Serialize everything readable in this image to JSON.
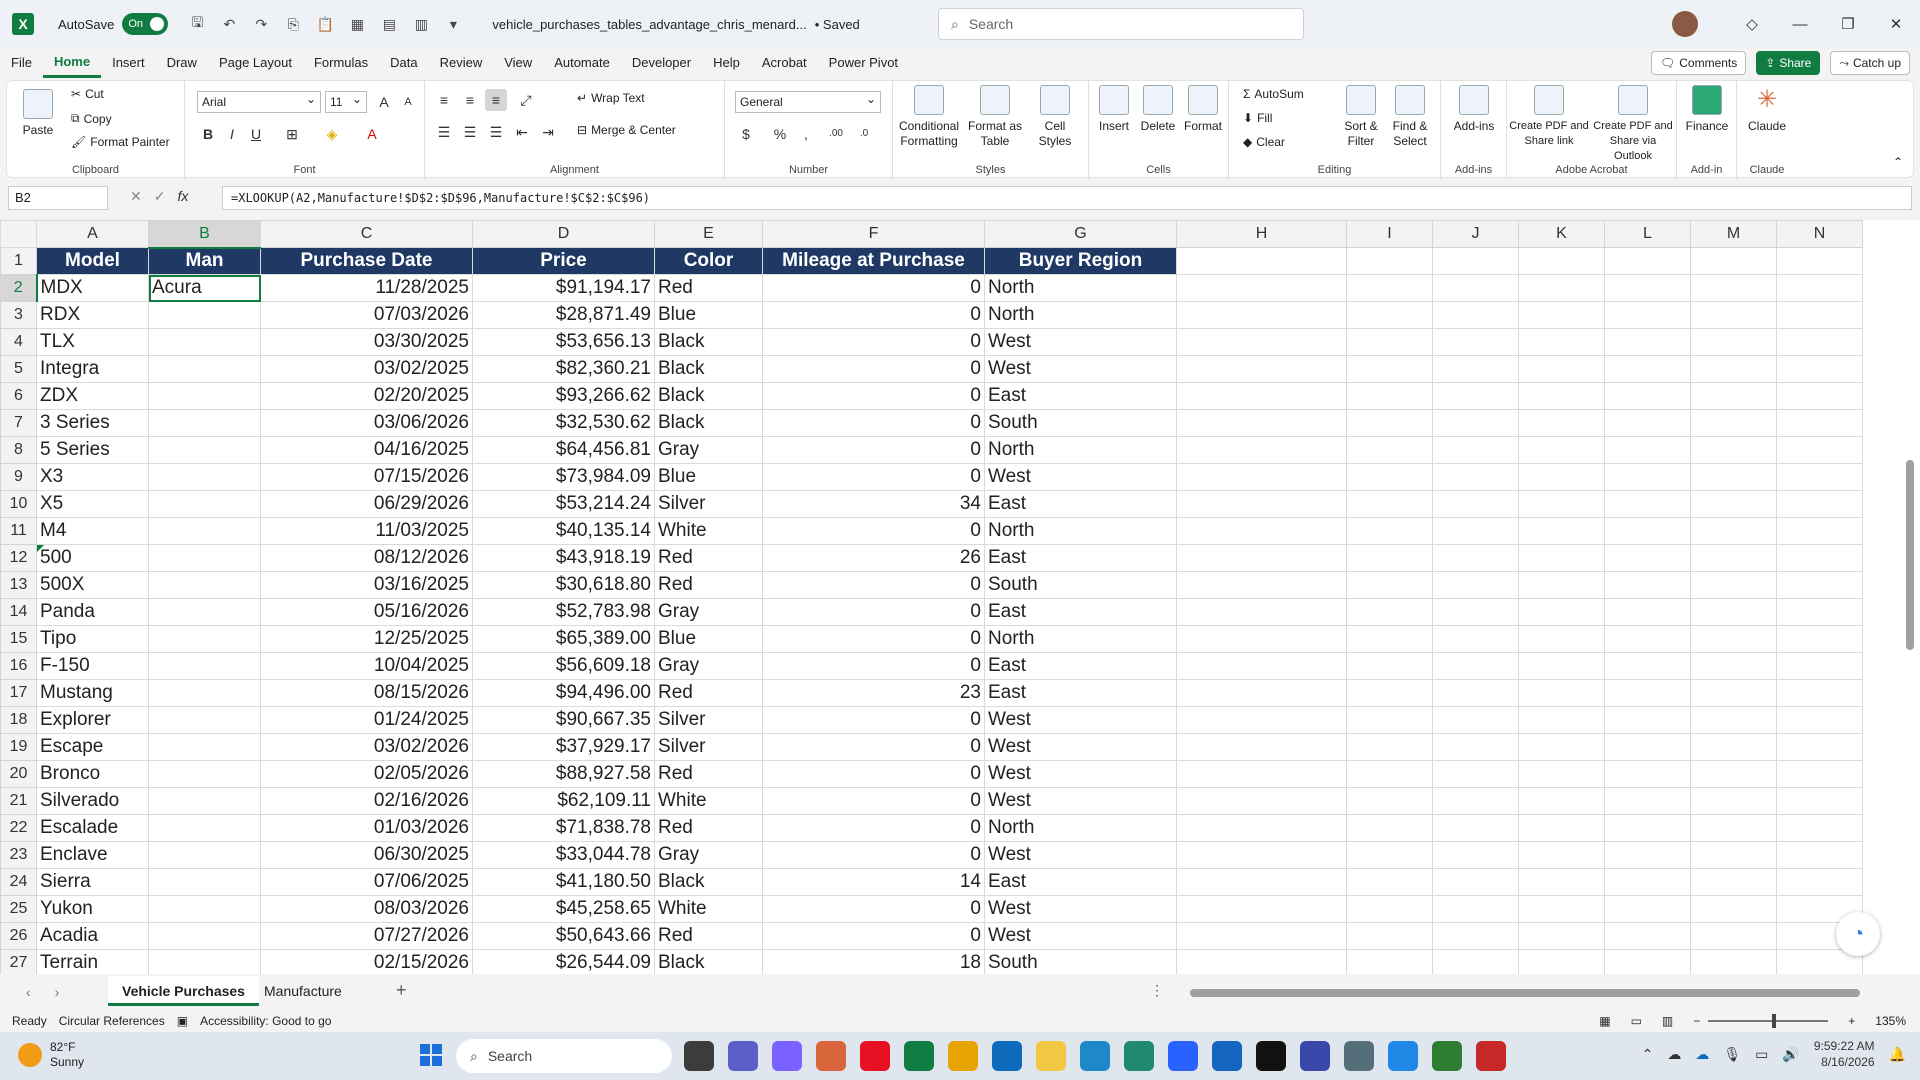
{
  "titlebar": {
    "autosave_label": "AutoSave",
    "autosave_state": "On",
    "filename": "vehicle_purchases_tables_advantage_chris_menard...",
    "saved_status": "• Saved",
    "search_placeholder": "Search"
  },
  "menu": {
    "tabs": [
      "File",
      "Home",
      "Insert",
      "Draw",
      "Page Layout",
      "Formulas",
      "Data",
      "Review",
      "View",
      "Automate",
      "Developer",
      "Help",
      "Acrobat",
      "Power Pivot"
    ],
    "comments": "Comments",
    "share": "Share",
    "catchup": "Catch up"
  },
  "ribbon": {
    "clipboard": {
      "paste": "Paste",
      "cut": "Cut",
      "copy": "Copy",
      "format_painter": "Format Painter",
      "label": "Clipboard"
    },
    "font": {
      "name": "Arial",
      "size": "11",
      "label": "Font"
    },
    "alignment": {
      "wrap": "Wrap Text",
      "merge": "Merge & Center",
      "label": "Alignment"
    },
    "number": {
      "format": "General",
      "label": "Number"
    },
    "styles": {
      "conditional": "Conditional Formatting",
      "format_table": "Format as Table",
      "cell_styles": "Cell Styles",
      "label": "Styles"
    },
    "cells": {
      "insert": "Insert",
      "delete": "Delete",
      "format": "Format",
      "label": "Cells"
    },
    "editing": {
      "autosum": "AutoSum",
      "fill": "Fill",
      "clear": "Clear",
      "sort": "Sort & Filter",
      "find": "Find & Select",
      "label": "Editing"
    },
    "addins": {
      "addins": "Add-ins",
      "label": "Add-ins"
    },
    "acrobat": {
      "pdf_share": "Create PDF and Share link",
      "pdf_outlook": "Create PDF and Share via Outlook",
      "label": "Adobe Acrobat"
    },
    "finance": {
      "finance": "Finance",
      "label": "Add-in"
    },
    "claude": {
      "claude": "Claude",
      "label": "Claude"
    }
  },
  "formula_bar": {
    "name_box": "B2",
    "formula": "=XLOOKUP(A2,Manufacture!$D$2:$D$96,Manufacture!$C$2:$C$96)"
  },
  "grid": {
    "columns": [
      "A",
      "B",
      "C",
      "D",
      "E",
      "F",
      "G",
      "H",
      "I",
      "J",
      "K",
      "L",
      "M",
      "N"
    ],
    "headers": [
      "Model",
      "Man",
      "Purchase Date",
      "Price",
      "Color",
      "Mileage at Purchase",
      "Buyer Region"
    ],
    "rows": [
      [
        "MDX",
        "Acura",
        "11/28/2025",
        "$91,194.17",
        "Red",
        "0",
        "North"
      ],
      [
        "RDX",
        "",
        "07/03/2026",
        "$28,871.49",
        "Blue",
        "0",
        "North"
      ],
      [
        "TLX",
        "",
        "03/30/2025",
        "$53,656.13",
        "Black",
        "0",
        "West"
      ],
      [
        "Integra",
        "",
        "03/02/2025",
        "$82,360.21",
        "Black",
        "0",
        "West"
      ],
      [
        "ZDX",
        "",
        "02/20/2025",
        "$93,266.62",
        "Black",
        "0",
        "East"
      ],
      [
        "3 Series",
        "",
        "03/06/2026",
        "$32,530.62",
        "Black",
        "0",
        "South"
      ],
      [
        "5 Series",
        "",
        "04/16/2025",
        "$64,456.81",
        "Gray",
        "0",
        "North"
      ],
      [
        "X3",
        "",
        "07/15/2026",
        "$73,984.09",
        "Blue",
        "0",
        "West"
      ],
      [
        "X5",
        "",
        "06/29/2026",
        "$53,214.24",
        "Silver",
        "34",
        "East"
      ],
      [
        "M4",
        "",
        "11/03/2025",
        "$40,135.14",
        "White",
        "0",
        "North"
      ],
      [
        "500",
        "",
        "08/12/2026",
        "$43,918.19",
        "Red",
        "26",
        "East"
      ],
      [
        "500X",
        "",
        "03/16/2025",
        "$30,618.80",
        "Red",
        "0",
        "South"
      ],
      [
        "Panda",
        "",
        "05/16/2026",
        "$52,783.98",
        "Gray",
        "0",
        "East"
      ],
      [
        "Tipo",
        "",
        "12/25/2025",
        "$65,389.00",
        "Blue",
        "0",
        "North"
      ],
      [
        "F-150",
        "",
        "10/04/2025",
        "$56,609.18",
        "Gray",
        "0",
        "East"
      ],
      [
        "Mustang",
        "",
        "08/15/2026",
        "$94,496.00",
        "Red",
        "23",
        "East"
      ],
      [
        "Explorer",
        "",
        "01/24/2025",
        "$90,667.35",
        "Silver",
        "0",
        "West"
      ],
      [
        "Escape",
        "",
        "03/02/2026",
        "$37,929.17",
        "Silver",
        "0",
        "West"
      ],
      [
        "Bronco",
        "",
        "02/05/2026",
        "$88,927.58",
        "Red",
        "0",
        "West"
      ],
      [
        "Silverado",
        "",
        "02/16/2026",
        "$62,109.11",
        "White",
        "0",
        "West"
      ],
      [
        "Escalade",
        "",
        "01/03/2026",
        "$71,838.78",
        "Red",
        "0",
        "North"
      ],
      [
        "Enclave",
        "",
        "06/30/2025",
        "$33,044.78",
        "Gray",
        "0",
        "West"
      ],
      [
        "Sierra",
        "",
        "07/06/2025",
        "$41,180.50",
        "Black",
        "14",
        "East"
      ],
      [
        "Yukon",
        "",
        "08/03/2026",
        "$45,258.65",
        "White",
        "0",
        "West"
      ],
      [
        "Acadia",
        "",
        "07/27/2026",
        "$50,643.66",
        "Red",
        "0",
        "West"
      ],
      [
        "Terrain",
        "",
        "02/15/2026",
        "$26,544.09",
        "Black",
        "18",
        "South"
      ]
    ],
    "header_color": "#1f3864",
    "selection_color": "#107c41"
  },
  "sheet_tabs": [
    "Vehicle Purchases",
    "Manufacture"
  ],
  "statusbar": {
    "ready": "Ready",
    "circular": "Circular References",
    "accessibility": "Accessibility: Good to go",
    "zoom": "135%"
  },
  "taskbar": {
    "temp": "82°F",
    "condition": "Sunny",
    "search": "Search",
    "time": "9:59:22 AM",
    "date": "8/16/2026"
  }
}
